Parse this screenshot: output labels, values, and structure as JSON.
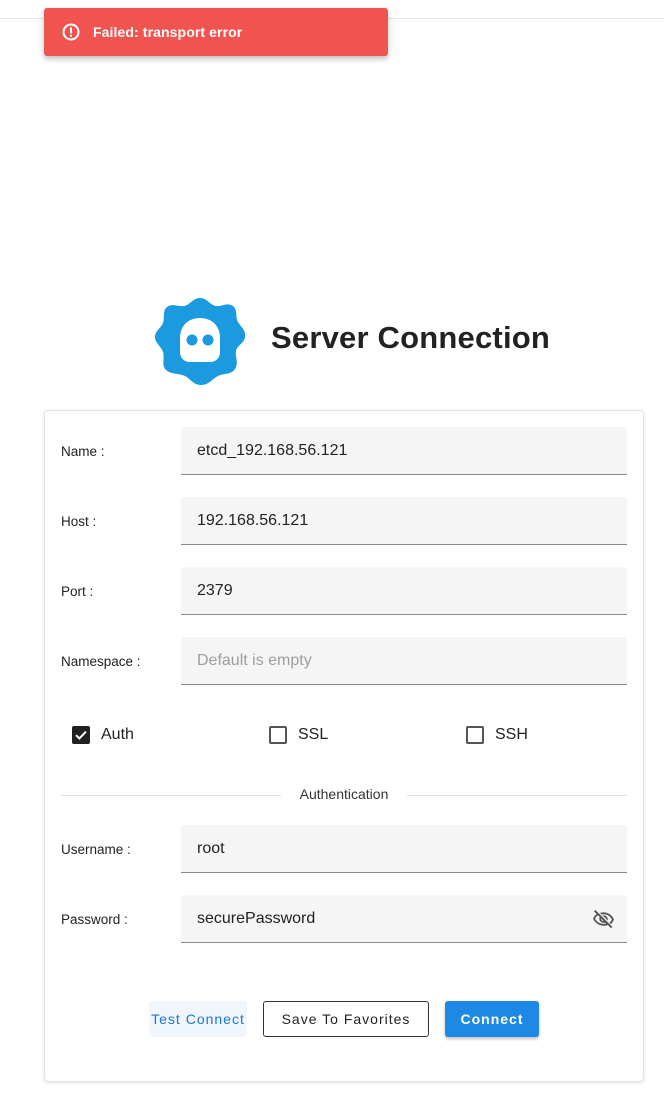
{
  "toast": {
    "message": "Failed: transport error",
    "icon": "error-icon",
    "color": "#f05451"
  },
  "header": {
    "title": "Server Connection",
    "logo": "etcd-logo",
    "logo_color": "#1b9ae0"
  },
  "form": {
    "name": {
      "label": "Name :",
      "value": "etcd_192.168.56.121",
      "placeholder": ""
    },
    "host": {
      "label": "Host :",
      "value": "192.168.56.121",
      "placeholder": ""
    },
    "port": {
      "label": "Port :",
      "value": "2379",
      "placeholder": ""
    },
    "namespace": {
      "label": "Namespace :",
      "value": "",
      "placeholder": "Default is empty"
    },
    "options": {
      "auth": {
        "label": "Auth",
        "checked": true
      },
      "ssl": {
        "label": "SSL",
        "checked": false
      },
      "ssh": {
        "label": "SSH",
        "checked": false
      }
    },
    "section_title": "Authentication",
    "username": {
      "label": "Username :",
      "value": "root"
    },
    "password": {
      "label": "Password :",
      "value": "securePassword",
      "toggle_icon": "eye-off-icon"
    }
  },
  "buttons": {
    "test": "Test Connect",
    "save": "Save To Favorites",
    "connect": "Connect"
  },
  "colors": {
    "primary": "#1e88e5",
    "error": "#f05451"
  }
}
